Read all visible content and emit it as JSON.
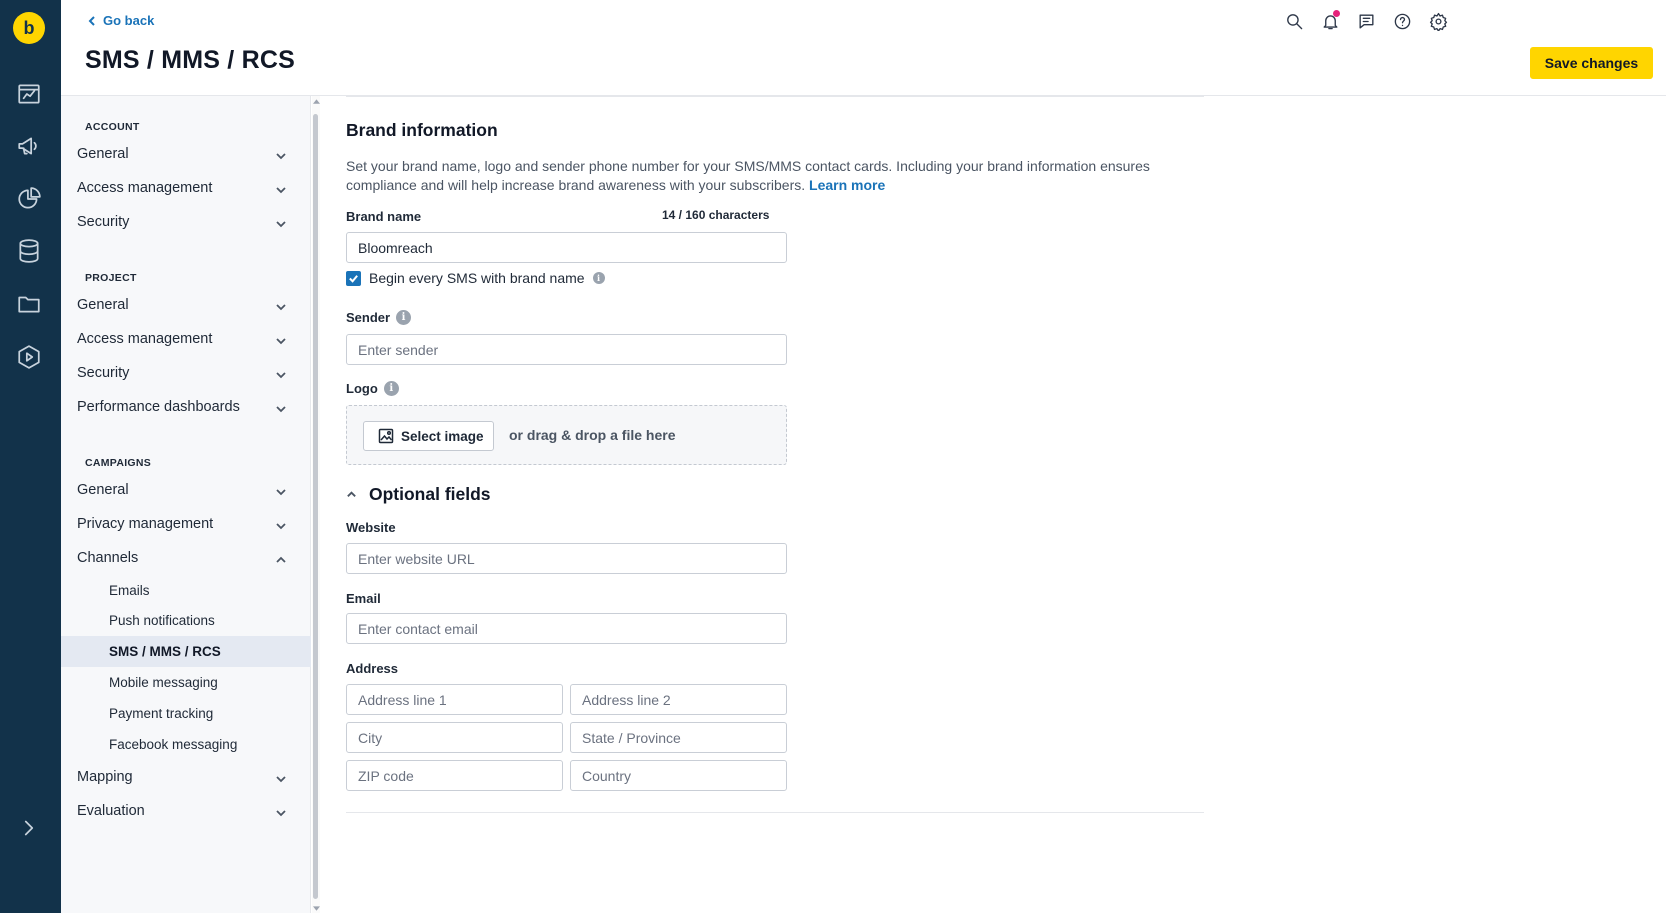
{
  "app": {
    "logo_letter": "b",
    "rail_icons": [
      "dashboard-icon",
      "campaigns-megaphone-icon",
      "analytics-pie-icon",
      "data-database-icon",
      "assets-folder-icon",
      "player-icon",
      "expand-icon"
    ]
  },
  "header": {
    "go_back": "Go back",
    "title": "SMS / MMS / RCS",
    "save_label": "Save changes",
    "icons": [
      "search-icon",
      "notifications-icon",
      "messages-icon",
      "help-icon",
      "settings-icon"
    ]
  },
  "sidebar": {
    "account": {
      "title": "ACCOUNT",
      "items": [
        "General",
        "Access management",
        "Security"
      ]
    },
    "project": {
      "title": "PROJECT",
      "items": [
        "General",
        "Access management",
        "Security",
        "Performance dashboards"
      ]
    },
    "campaigns": {
      "title": "CAMPAIGNS",
      "items": [
        "General",
        "Privacy management",
        "Channels"
      ],
      "channels": [
        "Emails",
        "Push notifications",
        "SMS / MMS / RCS",
        "Mobile messaging",
        "Payment tracking",
        "Facebook messaging"
      ],
      "after": [
        "Mapping",
        "Evaluation"
      ],
      "active_channel": "SMS / MMS / RCS"
    }
  },
  "brand": {
    "title": "Brand information",
    "description": "Set your brand name, logo and sender phone number for your SMS/MMS contact cards. Including your brand information ensures compliance and will help increase brand awareness with your subscribers.",
    "learn_more": "Learn more",
    "name_label": "Brand name",
    "counter": "14 / 160 characters",
    "name_value": "Bloomreach",
    "checkbox_label": "Begin every SMS with brand name",
    "checkbox_checked": true,
    "sender_label": "Sender",
    "sender_placeholder": "Enter sender",
    "logo_label": "Logo",
    "select_image": "Select image",
    "drop_text": "or drag & drop a file here"
  },
  "optional": {
    "title": "Optional fields",
    "website_label": "Website",
    "website_placeholder": "Enter website URL",
    "email_label": "Email",
    "email_placeholder": "Enter contact email",
    "address_label": "Address",
    "address_line1": "Address line 1",
    "address_line2": "Address line 2",
    "city": "City",
    "state": "State / Province",
    "zip": "ZIP code",
    "country": "Country"
  },
  "colors": {
    "rail": "#12324a",
    "accent_yellow": "#ffd500",
    "link_blue": "#1a73b8",
    "notification_dot": "#e6227a"
  }
}
